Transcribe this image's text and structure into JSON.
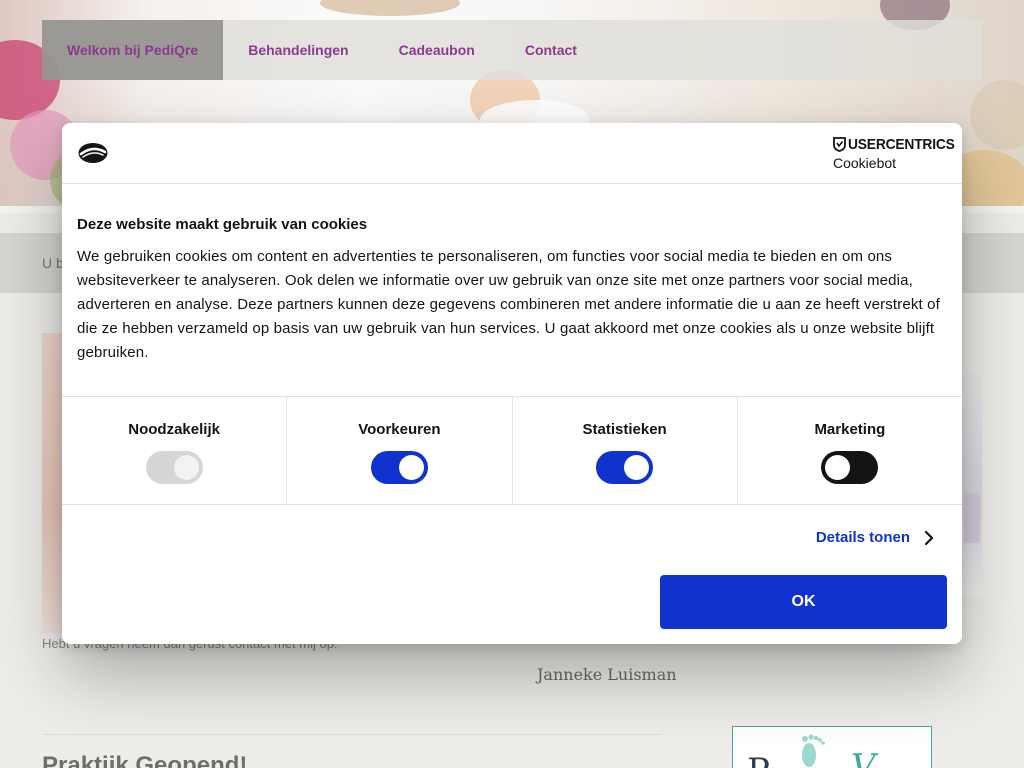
{
  "nav": {
    "items": [
      {
        "label": "Welkom bij PediQre",
        "active": true
      },
      {
        "label": "Behandelingen",
        "active": false
      },
      {
        "label": "Cadeaubon",
        "active": false
      },
      {
        "label": "Contact",
        "active": false
      }
    ]
  },
  "page": {
    "intro_partial": "U b",
    "contact_text": "Hebt u vragen neem dan gerust contact met mij op.",
    "signature": "Janneke Luisman",
    "section_title": "Praktijk Geopend!",
    "partner_logo_text_a": "P",
    "partner_logo_text_b": "V"
  },
  "dialog": {
    "brand": {
      "name": "USERCENTRICS",
      "product": "Cookiebot"
    },
    "title": "Deze website maakt gebruik van cookies",
    "body": "We gebruiken cookies om content en advertenties te personaliseren, om functies voor social media te bieden en om ons websiteverkeer te analyseren. Ook delen we informatie over uw gebruik van onze site met onze partners voor social media, adverteren en analyse. Deze partners kunnen deze gegevens combineren met andere informatie die u aan ze heeft verstrekt of die ze hebben verzameld op basis van uw gebruik van hun services. U gaat akkoord met onze cookies als u onze website blijft gebruiken.",
    "toggles": [
      {
        "label": "Noodzakelijk",
        "state": "on",
        "disabled": true
      },
      {
        "label": "Voorkeuren",
        "state": "on",
        "disabled": false
      },
      {
        "label": "Statistieken",
        "state": "on",
        "disabled": false
      },
      {
        "label": "Marketing",
        "state": "off",
        "disabled": false
      }
    ],
    "details_label": "Details tonen",
    "ok_label": "OK",
    "colors": {
      "accent": "#1032cf",
      "toggle_off": "#141414",
      "toggle_disabled": "#d6d6d6"
    }
  }
}
